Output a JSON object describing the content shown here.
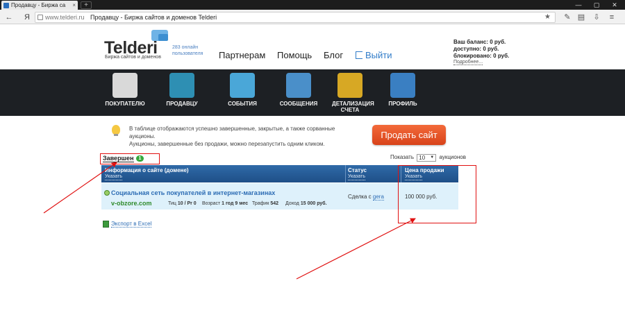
{
  "browser": {
    "tab_title": "Продавцу - Биржа са",
    "tab_close": "×",
    "new_tab": "+",
    "url_host": "www.telderi.ru",
    "page_title": "Продавцу - Биржа сайтов и доменов Telderi",
    "yandex_glyph": "Я",
    "star": "★",
    "win_min": "—",
    "win_max": "▢",
    "win_close": "✕"
  },
  "header": {
    "logo": "Telderi",
    "logo_sub": "Биржа сайтов и доменов",
    "online_line1": "283 онлайн",
    "online_line2": "пользователя",
    "nav": [
      "Партнерам",
      "Помощь",
      "Блог"
    ],
    "exit": "Выйти",
    "balance": "Ваш баланс: 0 руб.",
    "available": "доступно: 0 руб.",
    "blocked": "блокировано: 0 руб.",
    "more": "Подробнее..."
  },
  "menu": {
    "items": [
      {
        "label": "ПОКУПАТЕЛЮ",
        "icon": "magnifier-icon",
        "color": "#d9d9d9"
      },
      {
        "label": "ПРОДАВЦУ",
        "icon": "folder-icon",
        "color": "#2e8fb3"
      },
      {
        "label": "СОБЫТИЯ",
        "icon": "book-icon",
        "color": "#4aa7d8"
      },
      {
        "label": "СООБЩЕНИЯ",
        "icon": "envelope-icon",
        "color": "#4a8fc9"
      },
      {
        "label": "ДЕТАЛИЗАЦИЯ СЧЕТА",
        "icon": "coins-icon",
        "color": "#d7a824"
      },
      {
        "label": "ПРОФИЛЬ",
        "icon": "profile-icon",
        "color": "#3a7fc2"
      }
    ]
  },
  "content": {
    "info_line1": "В таблице отображаются успешно завершенные, закрытые, а также сорванные аукционы.",
    "info_line2": "Аукционы, завершенные без продажи, можно перезапустить одним кликом.",
    "sell_button": "Продать сайт",
    "tab_label": "Завершен",
    "tab_count": "1",
    "show_prefix": "Показать",
    "show_value": "10",
    "show_suffix": "аукционов"
  },
  "table": {
    "col_info": "Информация о сайте (домене)",
    "col_status": "Статус",
    "col_price": "Цена продажи",
    "sort": "Указать",
    "row": {
      "name": "Социальная сеть покупателей в интернет-магазинах",
      "url": "v-obzore.com",
      "tic_label": "Тиц",
      "tic": "10 / Pr 0",
      "age_label": "Возраст",
      "age": "1 год 9 мес",
      "traffic_label": "Трафик",
      "traffic": "542",
      "income_label": "Доход",
      "income": "15 000 руб.",
      "status_text": "Сделка с",
      "status_user": "gera",
      "price": "100 000 руб."
    }
  },
  "footer": {
    "export": "Экспорт в Excel"
  },
  "annotations": {
    "color": "#e01010"
  }
}
